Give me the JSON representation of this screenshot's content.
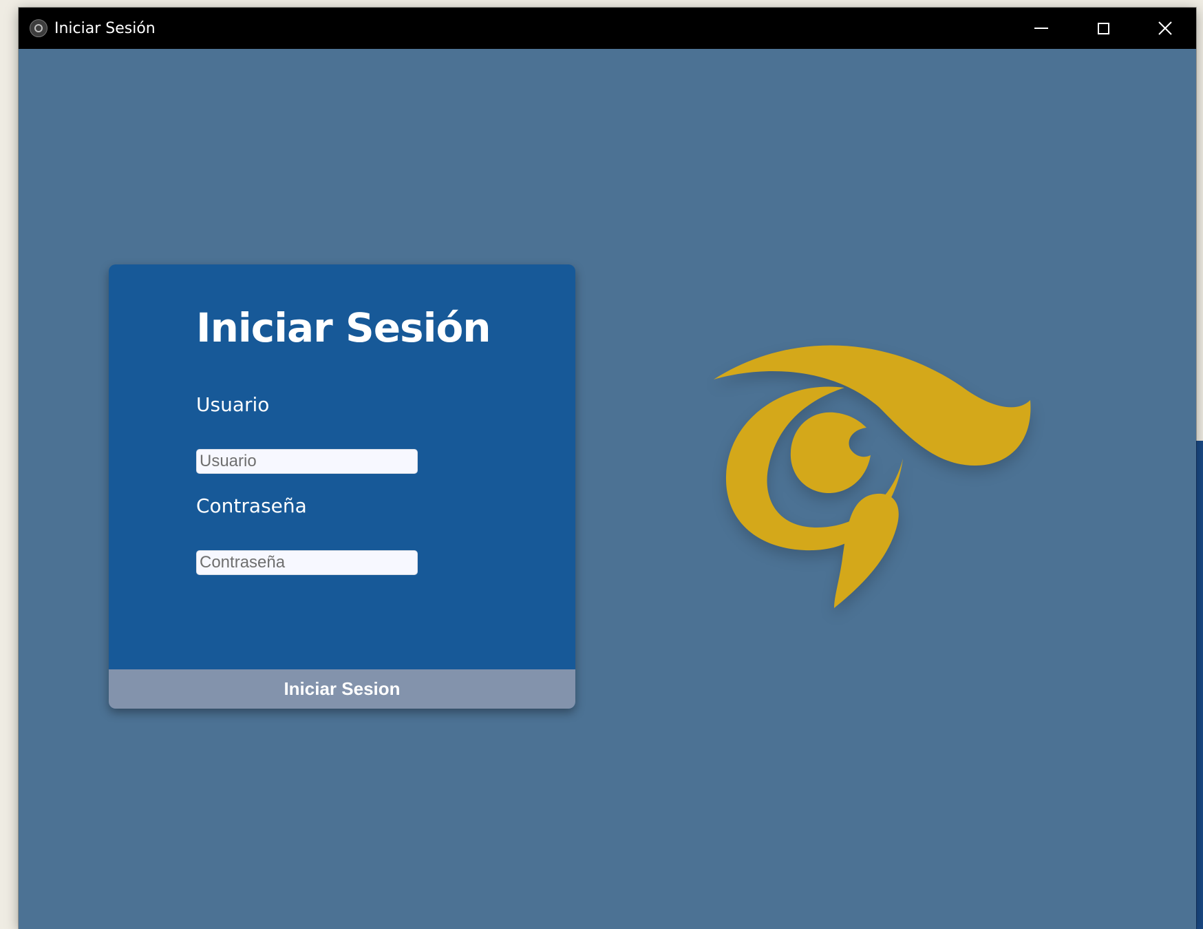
{
  "window": {
    "title": "Iniciar Sesión"
  },
  "login": {
    "heading": "Iniciar Sesión",
    "user_label": "Usuario",
    "user_placeholder": "Usuario",
    "password_label": "Contraseña",
    "password_placeholder": "Contraseña",
    "submit_label": "Iniciar Sesion"
  },
  "icons": {
    "app": "app-icon",
    "minimize": "minimize-icon",
    "maximize": "maximize-icon",
    "close": "close-icon",
    "logo": "eye-logo"
  },
  "colors": {
    "background": "#4c7294",
    "card": "#175998",
    "button": "#8393ac",
    "logo": "#d4a81a",
    "titlebar": "#000000"
  }
}
